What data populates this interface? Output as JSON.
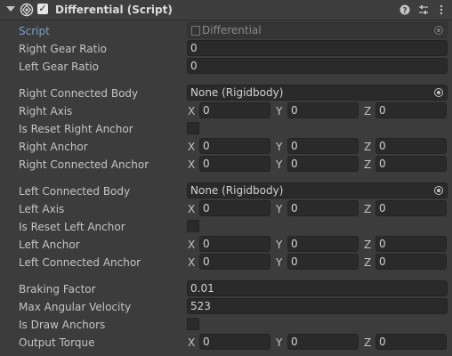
{
  "header": {
    "title": "Differential (Script)",
    "enabled": true,
    "icons": [
      "help-icon",
      "preset-sliders-icon",
      "context-menu-icon"
    ]
  },
  "script": {
    "label": "Script",
    "value": "Differential"
  },
  "fields": {
    "right_gear_ratio": {
      "label": "Right Gear Ratio",
      "value": "0"
    },
    "left_gear_ratio": {
      "label": "Left Gear Ratio",
      "value": "0"
    },
    "right_connected_body": {
      "label": "Right Connected Body",
      "value": "None (Rigidbody)"
    },
    "right_axis": {
      "label": "Right Axis",
      "x": "0",
      "y": "0",
      "z": "0"
    },
    "is_reset_right_anchor": {
      "label": "Is Reset Right Anchor",
      "checked": false
    },
    "right_anchor": {
      "label": "Right Anchor",
      "x": "0",
      "y": "0",
      "z": "0"
    },
    "right_connected_anchor": {
      "label": "Right Connected Anchor",
      "x": "0",
      "y": "0",
      "z": "0"
    },
    "left_connected_body": {
      "label": "Left Connected Body",
      "value": "None (Rigidbody)"
    },
    "left_axis": {
      "label": "Left Axis",
      "x": "0",
      "y": "0",
      "z": "0"
    },
    "is_reset_left_anchor": {
      "label": "Is Reset Left Anchor",
      "checked": false
    },
    "left_anchor": {
      "label": "Left Anchor",
      "x": "0",
      "y": "0",
      "z": "0"
    },
    "left_connected_anchor": {
      "label": "Left Connected Anchor",
      "x": "0",
      "y": "0",
      "z": "0"
    },
    "braking_factor": {
      "label": "Braking Factor",
      "value": "0.01"
    },
    "max_angular_velocity": {
      "label": "Max Angular Velocity",
      "value": "523"
    },
    "is_draw_anchors": {
      "label": "Is Draw Anchors",
      "checked": false
    },
    "output_torque": {
      "label": "Output Torque",
      "x": "0",
      "y": "0",
      "z": "0"
    }
  },
  "axis_labels": {
    "x": "X",
    "y": "Y",
    "z": "Z"
  },
  "colors": {
    "background": "#3c3c3c",
    "field": "#2a2a2a",
    "script_label": "#7c9fcf"
  }
}
